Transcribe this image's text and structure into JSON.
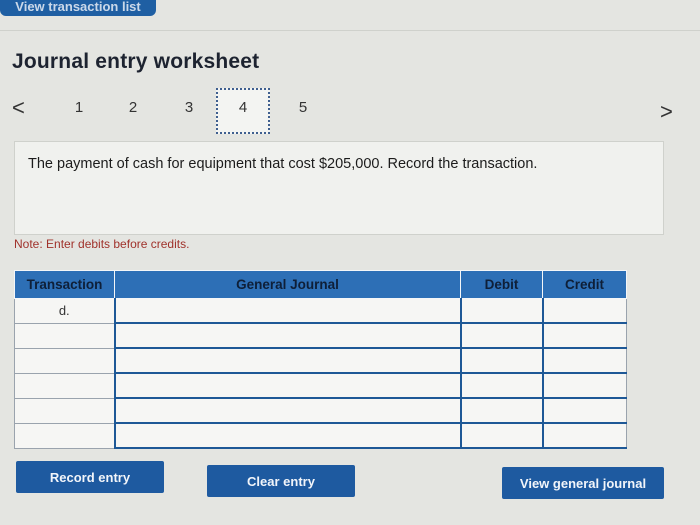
{
  "header": {
    "tab_label": "View transaction list",
    "title": "Journal entry worksheet"
  },
  "pager": {
    "prev_glyph": "<",
    "next_glyph": ">",
    "pages": [
      "1",
      "2",
      "3",
      "4",
      "5"
    ],
    "active_page": "4"
  },
  "question": {
    "text": "The payment of cash for equipment that cost $205,000. Record the transaction."
  },
  "note": "Note: Enter debits before credits.",
  "table": {
    "headers": {
      "transaction": "Transaction",
      "general_journal": "General Journal",
      "debit": "Debit",
      "credit": "Credit"
    },
    "rows": [
      {
        "transaction": "d."
      },
      {
        "transaction": ""
      },
      {
        "transaction": ""
      },
      {
        "transaction": ""
      },
      {
        "transaction": ""
      },
      {
        "transaction": ""
      }
    ]
  },
  "buttons": {
    "record": "Record entry",
    "clear": "Clear entry",
    "view_journal": "View general journal"
  },
  "colors": {
    "accent": "#1e5aa0",
    "header": "#2d6fb6",
    "note": "#a0322b"
  }
}
